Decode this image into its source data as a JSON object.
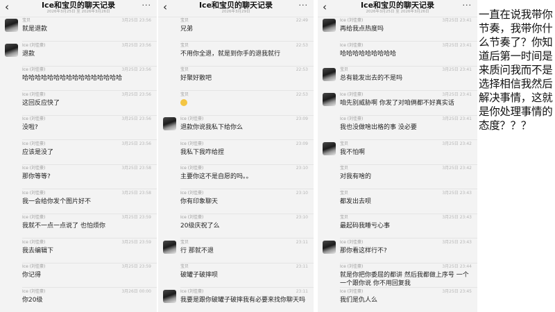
{
  "screens": [
    {
      "title": "Ice和宝贝的聊天记录",
      "subtitle": "2026年3月25日 至 2026年3月26日",
      "back_icon": "chevron-left-icon",
      "more_label": "···",
      "messages": [
        {
          "name": "宝贝",
          "time": "3月25日 23:56",
          "text": "就是退款",
          "avatar": true
        },
        {
          "name": "Ice (刘佳豪)",
          "time": "3月25日 23:56",
          "text": "退款",
          "avatar": true
        },
        {
          "name": "Ice (刘佳豪)",
          "time": "3月25日 23:56",
          "text": "哈哈哈哈哈哈哈哈哈哈哈哈哈哈哈哈"
        },
        {
          "name": "Ice (刘佳豪)",
          "time": "3月25日 23:56",
          "text": "这回反应快了"
        },
        {
          "name": "Ice (刘佳豪)",
          "time": "3月25日 23:56",
          "text": "没啦?"
        },
        {
          "name": "Ice (刘佳豪)",
          "time": "3月25日 23:56",
          "text": "应该是没了"
        },
        {
          "name": "Ice (刘佳豪)",
          "time": "3月25日 23:58",
          "text": "那你等等?"
        },
        {
          "name": "Ice (刘佳豪)",
          "time": "3月25日 23:58",
          "text": "我一会给你发个图片好不"
        },
        {
          "name": "Ice (刘佳豪)",
          "time": "3月25日 23:59",
          "text": "我就不一点一点说了 也怕烦你"
        },
        {
          "name": "Ice (刘佳豪)",
          "time": "3月25日 23:59",
          "text": "我去编辑下"
        },
        {
          "name": "Ice (刘佳豪)",
          "time": "3月25日 23:59",
          "text": "你记得"
        },
        {
          "name": "Ice (刘佳豪)",
          "time": "3月26日 00:00",
          "text": "你20级"
        }
      ]
    },
    {
      "title": "Ice和宝贝的聊天记录",
      "subtitle": "2026年3月29日",
      "back_icon": "chevron-left-icon",
      "more_label": "···",
      "messages": [
        {
          "name": "宝贝",
          "time": "22:49",
          "text": "兄弟"
        },
        {
          "name": "宝贝",
          "time": "22:53",
          "text": "不用你全退，就是到你手的退我就行"
        },
        {
          "name": "宝贝",
          "time": "22:53",
          "text": "好聚好散吧"
        },
        {
          "name": "宝贝",
          "time": "22:53",
          "text": "",
          "emoji": "smile-emoji"
        },
        {
          "name": "Ice (刘佳豪)",
          "time": "23:09",
          "text": "退款你说我私下给你么",
          "avatar": true
        },
        {
          "name": "Ice (刘佳豪)",
          "time": "23:09",
          "text": "我私下我咋给捏"
        },
        {
          "name": "Ice (刘佳豪)",
          "time": "23:10",
          "text": "主要你这不是自愿的吗。。"
        },
        {
          "name": "Ice (刘佳豪)",
          "time": "23:10",
          "text": "你有印象聊天"
        },
        {
          "name": "Ice (刘佳豪)",
          "time": "23:10",
          "text": "20级庆祝了么"
        },
        {
          "name": "宝贝",
          "time": "23:11",
          "text": "行 那就不退",
          "avatar": true
        },
        {
          "name": "宝贝",
          "time": "23:11",
          "text": "破罐子破摔呗"
        },
        {
          "name": "Ice (刘佳豪)",
          "time": "23:11",
          "text": "我要是跟你破罐子破摔我有必要来找你聊天吗",
          "avatar": true
        }
      ]
    },
    {
      "title": "Ice和宝贝的聊天记录",
      "subtitle": "2026年3月25日 至 2026年3月26日",
      "back_icon": "chevron-left-icon",
      "more_label": "···",
      "messages": [
        {
          "name": "Ice (刘佳豪)",
          "time": "3月25日 23:41",
          "text": "再给我点热度吗",
          "avatar": true
        },
        {
          "name": "Ice (刘佳豪)",
          "time": "3月25日 23:41",
          "text": "哈哈哈哈哈哈哈哈哈"
        },
        {
          "name": "宝贝",
          "time": "3月25日 23:41",
          "text": "总有能发出去的不是吗",
          "avatar": true
        },
        {
          "name": "Ice (刘佳豪)",
          "time": "3月25日 23:41",
          "text": "咱先别威胁啊 你发了对咱俩都不好真实话",
          "avatar": true
        },
        {
          "name": "Ice (刘佳豪)",
          "time": "3月25日 23:41",
          "text": "我也没做啥出格的事 没必要"
        },
        {
          "name": "宝贝",
          "time": "3月25日 23:42",
          "text": "我不怕啊",
          "avatar": true
        },
        {
          "name": "宝贝",
          "time": "3月25日 23:42",
          "text": "对我有啥的"
        },
        {
          "name": "宝贝",
          "time": "3月25日 23:43",
          "text": "都发出去呗"
        },
        {
          "name": "宝贝",
          "time": "3月25日 23:43",
          "text": "最起码我睡亏心事"
        },
        {
          "name": "Ice (刘佳豪)",
          "time": "3月25日 23:43",
          "text": "那你看这样行不?",
          "avatar": true
        },
        {
          "name": "Ice (刘佳豪)",
          "time": "3月25日 23:44",
          "text": "就是你把你委屈的都讲 然后我都做上序号 一个一个跟你说 你不用回复我",
          "wrap": true
        },
        {
          "name": "Ice (刘佳豪)",
          "time": "3月25日 23:45",
          "text": "我们是仇人么"
        }
      ]
    }
  ],
  "note": {
    "text": "一直在说我带你节奏，我带你什么节奏了？你知道后第一时间是来质问我而不是选择相信我然后解决事情，这就是你处理事情的态度？？？"
  }
}
